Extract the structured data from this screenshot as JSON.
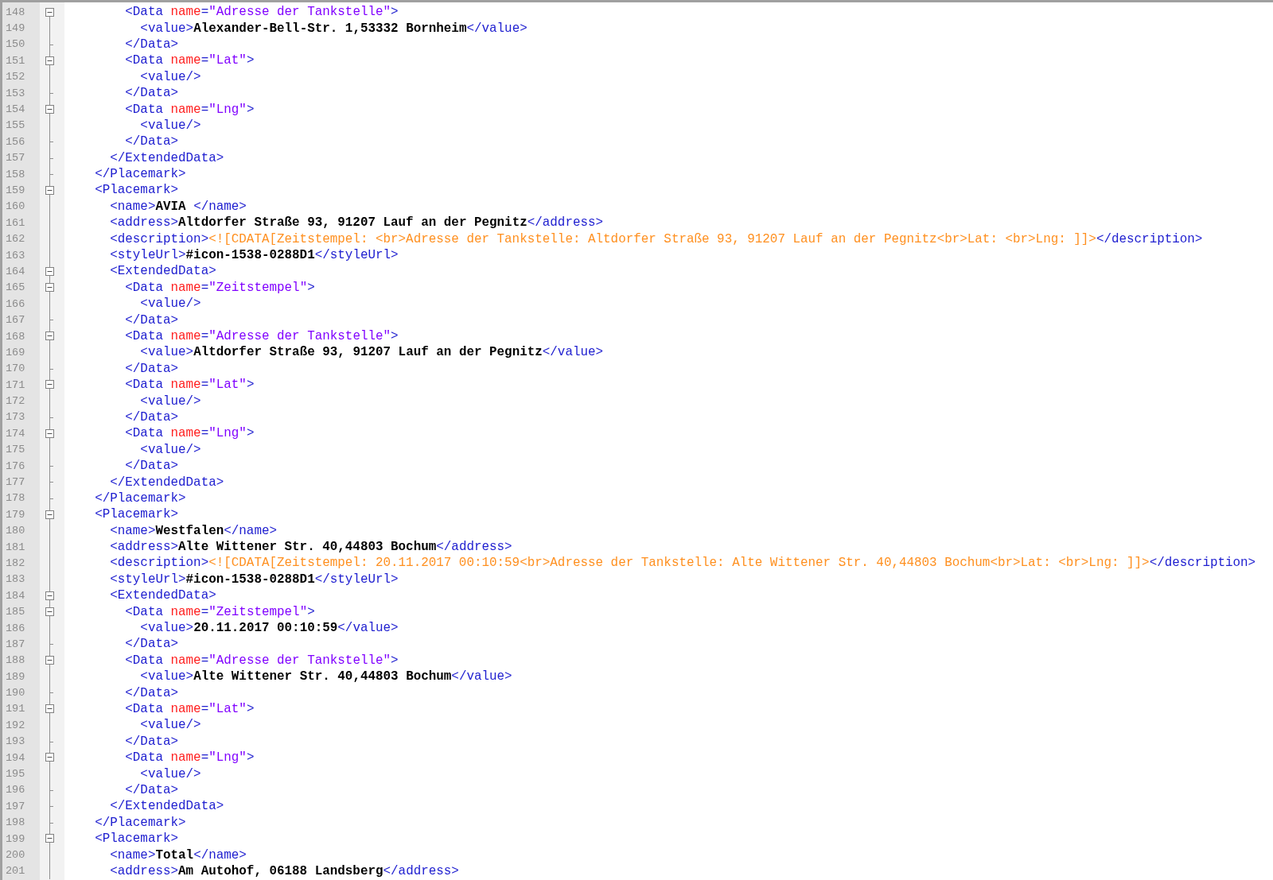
{
  "editor": {
    "lines": [
      {
        "number": "148",
        "kind": "open",
        "tokens": [
          {
            "kind": "tag",
            "text": "        <Data "
          },
          {
            "kind": "attr",
            "text": "name"
          },
          {
            "kind": "tag",
            "text": "="
          },
          {
            "kind": "string",
            "text": "\"Adresse der Tankstelle\""
          },
          {
            "kind": "tag",
            "text": ">"
          }
        ]
      },
      {
        "number": "149",
        "kind": "body",
        "tokens": [
          {
            "kind": "tag",
            "text": "          <value>"
          },
          {
            "kind": "text",
            "text": "Alexander-Bell-Str. 1,53332 Bornheim"
          },
          {
            "kind": "tag",
            "text": "</value>"
          }
        ]
      },
      {
        "number": "150",
        "kind": "end",
        "tokens": [
          {
            "kind": "tag",
            "text": "        </Data>"
          }
        ]
      },
      {
        "number": "151",
        "kind": "open",
        "tokens": [
          {
            "kind": "tag",
            "text": "        <Data "
          },
          {
            "kind": "attr",
            "text": "name"
          },
          {
            "kind": "tag",
            "text": "="
          },
          {
            "kind": "string",
            "text": "\"Lat\""
          },
          {
            "kind": "tag",
            "text": ">"
          }
        ]
      },
      {
        "number": "152",
        "kind": "body",
        "tokens": [
          {
            "kind": "tag",
            "text": "          <value/>"
          }
        ]
      },
      {
        "number": "153",
        "kind": "end",
        "tokens": [
          {
            "kind": "tag",
            "text": "        </Data>"
          }
        ]
      },
      {
        "number": "154",
        "kind": "open",
        "tokens": [
          {
            "kind": "tag",
            "text": "        <Data "
          },
          {
            "kind": "attr",
            "text": "name"
          },
          {
            "kind": "tag",
            "text": "="
          },
          {
            "kind": "string",
            "text": "\"Lng\""
          },
          {
            "kind": "tag",
            "text": ">"
          }
        ]
      },
      {
        "number": "155",
        "kind": "body",
        "tokens": [
          {
            "kind": "tag",
            "text": "          <value/>"
          }
        ]
      },
      {
        "number": "156",
        "kind": "end",
        "tokens": [
          {
            "kind": "tag",
            "text": "        </Data>"
          }
        ]
      },
      {
        "number": "157",
        "kind": "end",
        "tokens": [
          {
            "kind": "tag",
            "text": "      </ExtendedData>"
          }
        ]
      },
      {
        "number": "158",
        "kind": "end",
        "tokens": [
          {
            "kind": "tag",
            "text": "    </Placemark>"
          }
        ]
      },
      {
        "number": "159",
        "kind": "open",
        "tokens": [
          {
            "kind": "tag",
            "text": "    <Placemark>"
          }
        ]
      },
      {
        "number": "160",
        "kind": "body",
        "tokens": [
          {
            "kind": "tag",
            "text": "      <name>"
          },
          {
            "kind": "text",
            "text": "AVIA "
          },
          {
            "kind": "tag",
            "text": "</name>"
          }
        ]
      },
      {
        "number": "161",
        "kind": "body",
        "tokens": [
          {
            "kind": "tag",
            "text": "      <address>"
          },
          {
            "kind": "text",
            "text": "Altdorfer Straße 93, 91207 Lauf an der Pegnitz"
          },
          {
            "kind": "tag",
            "text": "</address>"
          }
        ]
      },
      {
        "number": "162",
        "kind": "body",
        "tokens": [
          {
            "kind": "tag",
            "text": "      <description>"
          },
          {
            "kind": "cdata",
            "text": "<![CDATA[Zeitstempel: <br>Adresse der Tankstelle: Altdorfer Straße 93, 91207 Lauf an der Pegnitz<br>Lat: <br>Lng: ]]>"
          },
          {
            "kind": "tag",
            "text": "</description>"
          }
        ]
      },
      {
        "number": "163",
        "kind": "body",
        "tokens": [
          {
            "kind": "tag",
            "text": "      <styleUrl>"
          },
          {
            "kind": "text",
            "text": "#icon-1538-0288D1"
          },
          {
            "kind": "tag",
            "text": "</styleUrl>"
          }
        ]
      },
      {
        "number": "164",
        "kind": "open",
        "tokens": [
          {
            "kind": "tag",
            "text": "      <ExtendedData>"
          }
        ]
      },
      {
        "number": "165",
        "kind": "open",
        "tokens": [
          {
            "kind": "tag",
            "text": "        <Data "
          },
          {
            "kind": "attr",
            "text": "name"
          },
          {
            "kind": "tag",
            "text": "="
          },
          {
            "kind": "string",
            "text": "\"Zeitstempel\""
          },
          {
            "kind": "tag",
            "text": ">"
          }
        ]
      },
      {
        "number": "166",
        "kind": "body",
        "tokens": [
          {
            "kind": "tag",
            "text": "          <value/>"
          }
        ]
      },
      {
        "number": "167",
        "kind": "end",
        "tokens": [
          {
            "kind": "tag",
            "text": "        </Data>"
          }
        ]
      },
      {
        "number": "168",
        "kind": "open",
        "tokens": [
          {
            "kind": "tag",
            "text": "        <Data "
          },
          {
            "kind": "attr",
            "text": "name"
          },
          {
            "kind": "tag",
            "text": "="
          },
          {
            "kind": "string",
            "text": "\"Adresse der Tankstelle\""
          },
          {
            "kind": "tag",
            "text": ">"
          }
        ]
      },
      {
        "number": "169",
        "kind": "body",
        "tokens": [
          {
            "kind": "tag",
            "text": "          <value>"
          },
          {
            "kind": "text",
            "text": "Altdorfer Straße 93, 91207 Lauf an der Pegnitz"
          },
          {
            "kind": "tag",
            "text": "</value>"
          }
        ]
      },
      {
        "number": "170",
        "kind": "end",
        "tokens": [
          {
            "kind": "tag",
            "text": "        </Data>"
          }
        ]
      },
      {
        "number": "171",
        "kind": "open",
        "tokens": [
          {
            "kind": "tag",
            "text": "        <Data "
          },
          {
            "kind": "attr",
            "text": "name"
          },
          {
            "kind": "tag",
            "text": "="
          },
          {
            "kind": "string",
            "text": "\"Lat\""
          },
          {
            "kind": "tag",
            "text": ">"
          }
        ]
      },
      {
        "number": "172",
        "kind": "body",
        "tokens": [
          {
            "kind": "tag",
            "text": "          <value/>"
          }
        ]
      },
      {
        "number": "173",
        "kind": "end",
        "tokens": [
          {
            "kind": "tag",
            "text": "        </Data>"
          }
        ]
      },
      {
        "number": "174",
        "kind": "open",
        "tokens": [
          {
            "kind": "tag",
            "text": "        <Data "
          },
          {
            "kind": "attr",
            "text": "name"
          },
          {
            "kind": "tag",
            "text": "="
          },
          {
            "kind": "string",
            "text": "\"Lng\""
          },
          {
            "kind": "tag",
            "text": ">"
          }
        ]
      },
      {
        "number": "175",
        "kind": "body",
        "tokens": [
          {
            "kind": "tag",
            "text": "          <value/>"
          }
        ]
      },
      {
        "number": "176",
        "kind": "end",
        "tokens": [
          {
            "kind": "tag",
            "text": "        </Data>"
          }
        ]
      },
      {
        "number": "177",
        "kind": "end",
        "tokens": [
          {
            "kind": "tag",
            "text": "      </ExtendedData>"
          }
        ]
      },
      {
        "number": "178",
        "kind": "end",
        "tokens": [
          {
            "kind": "tag",
            "text": "    </Placemark>"
          }
        ]
      },
      {
        "number": "179",
        "kind": "open",
        "tokens": [
          {
            "kind": "tag",
            "text": "    <Placemark>"
          }
        ]
      },
      {
        "number": "180",
        "kind": "body",
        "tokens": [
          {
            "kind": "tag",
            "text": "      <name>"
          },
          {
            "kind": "text",
            "text": "Westfalen"
          },
          {
            "kind": "tag",
            "text": "</name>"
          }
        ]
      },
      {
        "number": "181",
        "kind": "body",
        "tokens": [
          {
            "kind": "tag",
            "text": "      <address>"
          },
          {
            "kind": "text",
            "text": "Alte Wittener Str. 40,44803 Bochum"
          },
          {
            "kind": "tag",
            "text": "</address>"
          }
        ]
      },
      {
        "number": "182",
        "kind": "body",
        "tokens": [
          {
            "kind": "tag",
            "text": "      <description>"
          },
          {
            "kind": "cdata",
            "text": "<![CDATA[Zeitstempel: 20.11.2017 00:10:59<br>Adresse der Tankstelle: Alte Wittener Str. 40,44803 Bochum<br>Lat: <br>Lng: ]]>"
          },
          {
            "kind": "tag",
            "text": "</description>"
          }
        ]
      },
      {
        "number": "183",
        "kind": "body",
        "tokens": [
          {
            "kind": "tag",
            "text": "      <styleUrl>"
          },
          {
            "kind": "text",
            "text": "#icon-1538-0288D1"
          },
          {
            "kind": "tag",
            "text": "</styleUrl>"
          }
        ]
      },
      {
        "number": "184",
        "kind": "open",
        "tokens": [
          {
            "kind": "tag",
            "text": "      <ExtendedData>"
          }
        ]
      },
      {
        "number": "185",
        "kind": "open",
        "tokens": [
          {
            "kind": "tag",
            "text": "        <Data "
          },
          {
            "kind": "attr",
            "text": "name"
          },
          {
            "kind": "tag",
            "text": "="
          },
          {
            "kind": "string",
            "text": "\"Zeitstempel\""
          },
          {
            "kind": "tag",
            "text": ">"
          }
        ]
      },
      {
        "number": "186",
        "kind": "body",
        "tokens": [
          {
            "kind": "tag",
            "text": "          <value>"
          },
          {
            "kind": "text",
            "text": "20.11.2017 00:10:59"
          },
          {
            "kind": "tag",
            "text": "</value>"
          }
        ]
      },
      {
        "number": "187",
        "kind": "end",
        "tokens": [
          {
            "kind": "tag",
            "text": "        </Data>"
          }
        ]
      },
      {
        "number": "188",
        "kind": "open",
        "tokens": [
          {
            "kind": "tag",
            "text": "        <Data "
          },
          {
            "kind": "attr",
            "text": "name"
          },
          {
            "kind": "tag",
            "text": "="
          },
          {
            "kind": "string",
            "text": "\"Adresse der Tankstelle\""
          },
          {
            "kind": "tag",
            "text": ">"
          }
        ]
      },
      {
        "number": "189",
        "kind": "body",
        "tokens": [
          {
            "kind": "tag",
            "text": "          <value>"
          },
          {
            "kind": "text",
            "text": "Alte Wittener Str. 40,44803 Bochum"
          },
          {
            "kind": "tag",
            "text": "</value>"
          }
        ]
      },
      {
        "number": "190",
        "kind": "end",
        "tokens": [
          {
            "kind": "tag",
            "text": "        </Data>"
          }
        ]
      },
      {
        "number": "191",
        "kind": "open",
        "tokens": [
          {
            "kind": "tag",
            "text": "        <Data "
          },
          {
            "kind": "attr",
            "text": "name"
          },
          {
            "kind": "tag",
            "text": "="
          },
          {
            "kind": "string",
            "text": "\"Lat\""
          },
          {
            "kind": "tag",
            "text": ">"
          }
        ]
      },
      {
        "number": "192",
        "kind": "body",
        "tokens": [
          {
            "kind": "tag",
            "text": "          <value/>"
          }
        ]
      },
      {
        "number": "193",
        "kind": "end",
        "tokens": [
          {
            "kind": "tag",
            "text": "        </Data>"
          }
        ]
      },
      {
        "number": "194",
        "kind": "open",
        "tokens": [
          {
            "kind": "tag",
            "text": "        <Data "
          },
          {
            "kind": "attr",
            "text": "name"
          },
          {
            "kind": "tag",
            "text": "="
          },
          {
            "kind": "string",
            "text": "\"Lng\""
          },
          {
            "kind": "tag",
            "text": ">"
          }
        ]
      },
      {
        "number": "195",
        "kind": "body",
        "tokens": [
          {
            "kind": "tag",
            "text": "          <value/>"
          }
        ]
      },
      {
        "number": "196",
        "kind": "end",
        "tokens": [
          {
            "kind": "tag",
            "text": "        </Data>"
          }
        ]
      },
      {
        "number": "197",
        "kind": "end",
        "tokens": [
          {
            "kind": "tag",
            "text": "      </ExtendedData>"
          }
        ]
      },
      {
        "number": "198",
        "kind": "end",
        "tokens": [
          {
            "kind": "tag",
            "text": "    </Placemark>"
          }
        ]
      },
      {
        "number": "199",
        "kind": "open",
        "tokens": [
          {
            "kind": "tag",
            "text": "    <Placemark>"
          }
        ]
      },
      {
        "number": "200",
        "kind": "body",
        "tokens": [
          {
            "kind": "tag",
            "text": "      <name>"
          },
          {
            "kind": "text",
            "text": "Total"
          },
          {
            "kind": "tag",
            "text": "</name>"
          }
        ]
      },
      {
        "number": "201",
        "kind": "body",
        "tokens": [
          {
            "kind": "tag",
            "text": "      <address>"
          },
          {
            "kind": "text",
            "text": "Am Autohof, 06188 Landsberg"
          },
          {
            "kind": "tag",
            "text": "</address>"
          }
        ]
      }
    ]
  }
}
